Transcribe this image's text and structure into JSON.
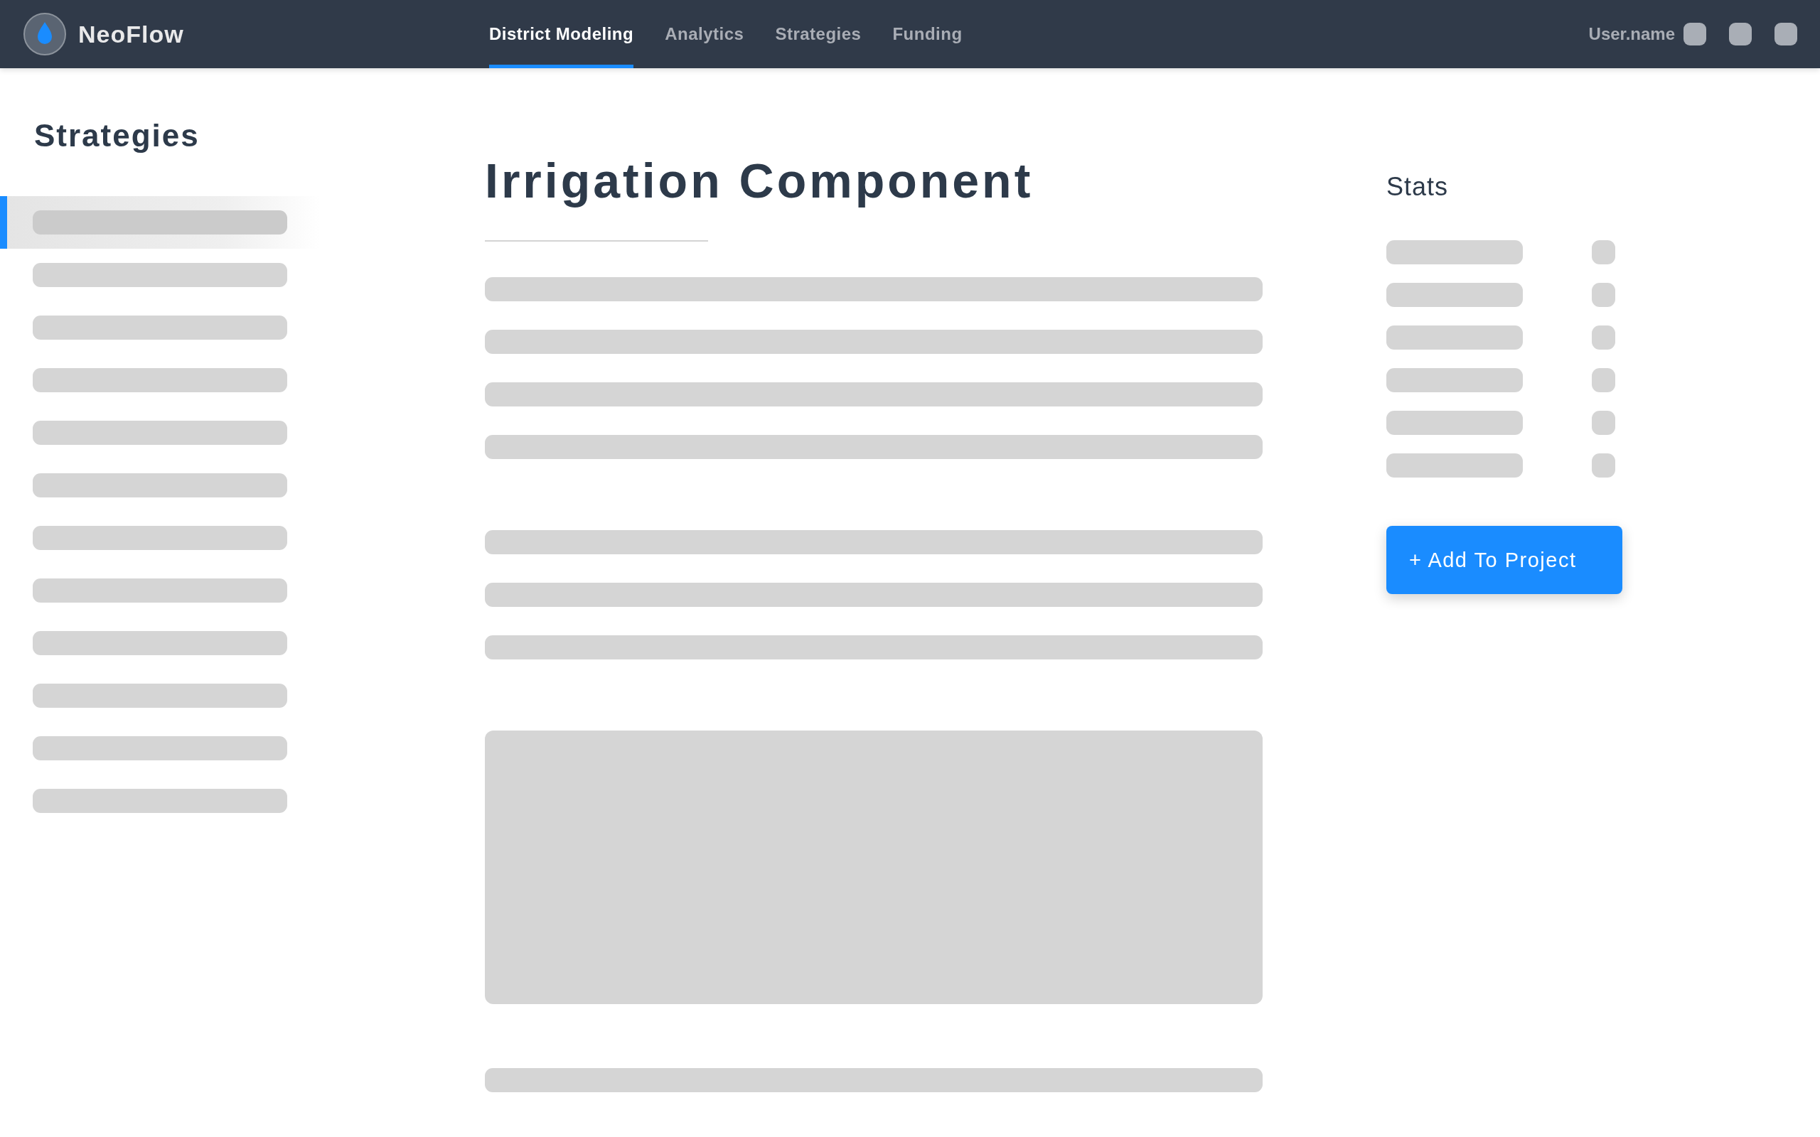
{
  "header": {
    "brand": "NeoFlow",
    "tabs": [
      {
        "label": "District Modeling",
        "selected": true
      },
      {
        "label": "Analytics",
        "selected": false
      },
      {
        "label": "Strategies",
        "selected": false
      },
      {
        "label": "Funding",
        "selected": false
      }
    ],
    "user": "User.name"
  },
  "sidebar": {
    "title": "Strategies",
    "items": [
      {
        "selected": true
      },
      {
        "selected": false
      },
      {
        "selected": false
      },
      {
        "selected": false
      },
      {
        "selected": false
      },
      {
        "selected": false
      },
      {
        "selected": false
      },
      {
        "selected": false
      },
      {
        "selected": false
      },
      {
        "selected": false
      },
      {
        "selected": false
      },
      {
        "selected": false
      }
    ]
  },
  "main": {
    "title": "Irrigation Component",
    "body": [
      {
        "kind": "text",
        "lines": [
          {
            "kind": "line"
          },
          {
            "kind": "line"
          },
          {
            "kind": "line"
          },
          {
            "kind": "line"
          }
        ]
      },
      {
        "kind": "text",
        "lines": [
          {
            "kind": "line"
          },
          {
            "kind": "line"
          },
          {
            "kind": "line"
          }
        ]
      },
      {
        "kind": "figure"
      },
      {
        "kind": "text",
        "lines": [
          {
            "kind": "line"
          }
        ]
      }
    ]
  },
  "stats": {
    "title": "Stats",
    "rows": [
      {
        "kind": "row"
      },
      {
        "kind": "row"
      },
      {
        "kind": "row"
      },
      {
        "kind": "row"
      },
      {
        "kind": "row"
      },
      {
        "kind": "row"
      }
    ],
    "button": "+ Add To Project"
  }
}
